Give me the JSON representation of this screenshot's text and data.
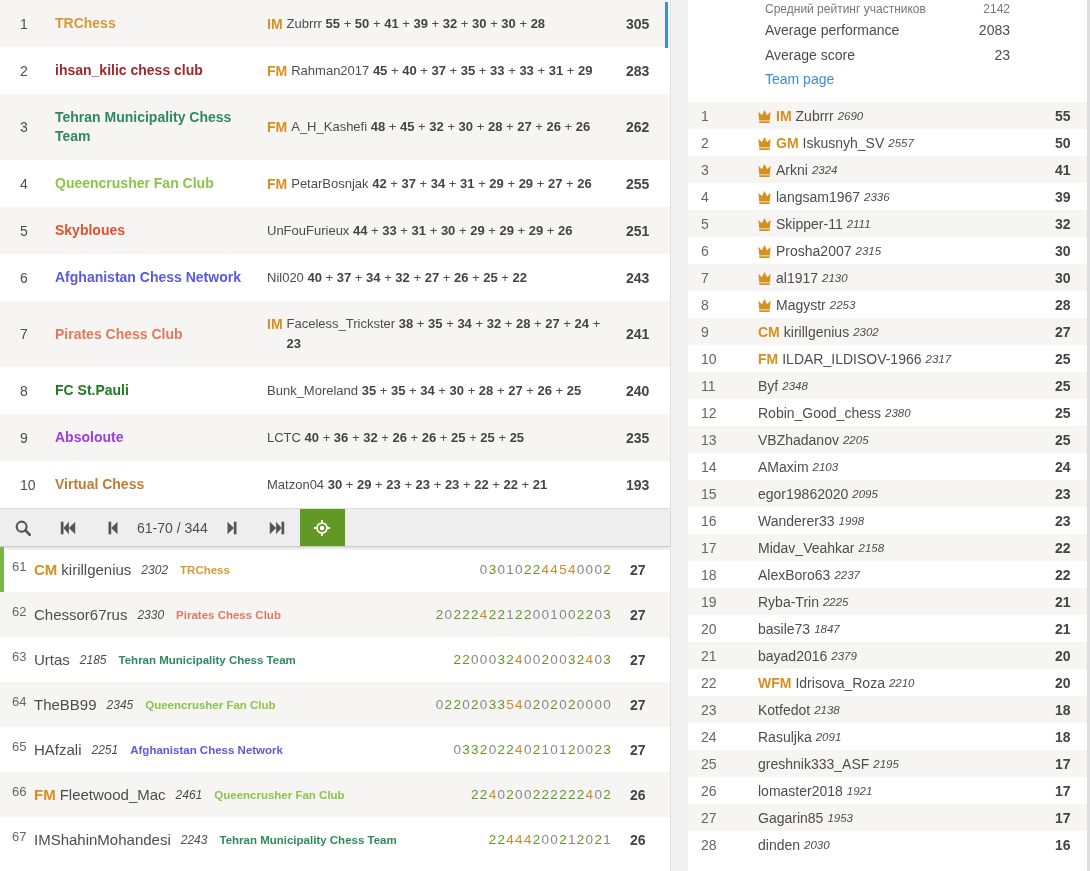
{
  "team_standings": {
    "rows": [
      {
        "rank": "1",
        "team": "TRChess",
        "color": "#d59a35",
        "leader": {
          "title": "IM",
          "line": "Zubrrr **55** + **50** + **41** + **39** + **32** + **30** + **30** + **28**"
        },
        "total": "305"
      },
      {
        "rank": "2",
        "team": "ihsan_kilic chess club",
        "color": "#a3282e",
        "leader": {
          "title": "FM",
          "line": "Rahman2017 **45** + **40** + **37** + **35** + **33** + **33** + **31** + **29**"
        },
        "total": "283"
      },
      {
        "rank": "3",
        "team": "Tehran Municipality Chess Team",
        "color": "#2e8a5c",
        "leader": {
          "title": "FM",
          "line": "A_H_Kashefi **48** + **45** + **32** + **30** + **28** + **27** + **26** + **26**"
        },
        "total": "262"
      },
      {
        "rank": "4",
        "team": "Queencrusher Fan Club",
        "color": "#8cc44a",
        "leader": {
          "title": "FM",
          "line": "PetarBosnjak **42** + **37** + **34** + **31** + **29** + **29** + **27** + **26**"
        },
        "total": "255"
      },
      {
        "rank": "5",
        "team": "Skybloues",
        "color": "#e4502a",
        "leader": {
          "line": "UnFouFurieux **44** + **33** + **31** + **30** + **29** + **29** + **29** + **26**"
        },
        "total": "251"
      },
      {
        "rank": "6",
        "team": "Afghanistan Chess Network",
        "color": "#5a5ae0",
        "leader": {
          "line": "Nil020 **40** + **37** + **34** + **32** + **27** + **26** + **25** + **22**"
        },
        "total": "243"
      },
      {
        "rank": "7",
        "team": "Pirates Chess Club",
        "color": "#e07a5c",
        "leader": {
          "title": "IM",
          "line": "Faceless_Trickster **38** + **35** + **34** + **32** + **28** + **27** + **24** + **23**"
        },
        "total": "241"
      },
      {
        "rank": "8",
        "team": "FC St.Pauli",
        "color": "#1f7a22",
        "leader": {
          "line": "Bunk_Moreland **35** + **35** + **34** + **30** + **28** + **27** + **26** + **25**"
        },
        "total": "240"
      },
      {
        "rank": "9",
        "team": "Absoloute",
        "color": "#9a3ee0",
        "leader": {
          "line": "LCTC **40** + **36** + **32** + **26** + **26** + **25** + **25** + **25**"
        },
        "total": "235"
      },
      {
        "rank": "10",
        "team": "Virtual Chess",
        "color": "#c27a35",
        "leader": {
          "line": "Matzon04 **30** + **29** + **23** + **23** + **23** + **22** + **22** + **21**"
        },
        "total": "193"
      }
    ]
  },
  "pager": {
    "range": "61-70 / 344"
  },
  "players": [
    {
      "rank": "61",
      "title": "CM",
      "name": "kirillgenius",
      "rating": "2302",
      "team": "TRChess",
      "color": "#d59a35",
      "sheet": "030102244540002",
      "score": "27",
      "selected": true
    },
    {
      "rank": "62",
      "name": "Chessor67rus",
      "rating": "2330",
      "team": "Pirates Chess Club",
      "color": "#e07a5c",
      "sheet": "20222422122001002203",
      "score": "27",
      "selected": false
    },
    {
      "rank": "63",
      "name": "Urtas",
      "rating": "2185",
      "team": "Tehran Municipality Chess Team",
      "color": "#2e8a5c",
      "sheet": "220003240020032403",
      "score": "27",
      "selected": false
    },
    {
      "rank": "64",
      "name": "TheBB99",
      "rating": "2345",
      "team": "Queencrusher Fan Club",
      "color": "#8cc44a",
      "sheet": "02202033540202020000",
      "score": "27",
      "selected": false
    },
    {
      "rank": "65",
      "name": "HAfzali",
      "rating": "2251",
      "team": "Afghanistan Chess Network",
      "color": "#5a5ae0",
      "sheet": "033202240210120023",
      "score": "27",
      "selected": false
    },
    {
      "rank": "66",
      "title": "FM",
      "name": "Fleetwood_Mac",
      "rating": "2461",
      "team": "Queencrusher Fan Club",
      "color": "#8cc44a",
      "sheet": "2240200222222402",
      "score": "26",
      "selected": false
    },
    {
      "rank": "67",
      "name": "IMShahinMohandesi",
      "rating": "2243",
      "team": "Tehran Municipality Chess Team",
      "color": "#2e8a5c",
      "sheet": "22444200212021",
      "score": "26",
      "selected": false
    }
  ],
  "team_info": {
    "stats": [
      {
        "label": "Средний рейтинг участников",
        "value": "2142"
      },
      {
        "label": "Average performance",
        "value": "2083"
      },
      {
        "label": "Average score",
        "value": "23"
      }
    ],
    "link": "Team page"
  },
  "members": [
    {
      "rank": "1",
      "crown": true,
      "title": "IM",
      "name": "Zubrrr",
      "rating": "2690",
      "score": "55"
    },
    {
      "rank": "2",
      "crown": true,
      "title": "GM",
      "name": "Iskusnyh_SV",
      "rating": "2557",
      "score": "50"
    },
    {
      "rank": "3",
      "crown": true,
      "name": "Arkni",
      "rating": "2324",
      "score": "41"
    },
    {
      "rank": "4",
      "crown": true,
      "name": "langsam1967",
      "rating": "2336",
      "score": "39"
    },
    {
      "rank": "5",
      "crown": true,
      "name": "Skipper-11",
      "rating": "2111",
      "score": "32"
    },
    {
      "rank": "6",
      "crown": true,
      "name": "Prosha2007",
      "rating": "2315",
      "score": "30"
    },
    {
      "rank": "7",
      "crown": true,
      "name": "al1917",
      "rating": "2130",
      "score": "30"
    },
    {
      "rank": "8",
      "crown": true,
      "name": "Magystr",
      "rating": "2253",
      "score": "28"
    },
    {
      "rank": "9",
      "crown": false,
      "title": "CM",
      "name": "kirillgenius",
      "rating": "2302",
      "score": "27"
    },
    {
      "rank": "10",
      "crown": false,
      "title": "FM",
      "name": "ILDAR_ILDISOV-1966",
      "rating": "2317",
      "score": "25"
    },
    {
      "rank": "11",
      "crown": false,
      "name": "Byf",
      "rating": "2348",
      "score": "25"
    },
    {
      "rank": "12",
      "crown": false,
      "name": "Robin_Good_chess",
      "rating": "2380",
      "score": "25"
    },
    {
      "rank": "13",
      "crown": false,
      "name": "VBZhadanov",
      "rating": "2205",
      "score": "25"
    },
    {
      "rank": "14",
      "crown": false,
      "name": "AMaxim",
      "rating": "2103",
      "score": "24"
    },
    {
      "rank": "15",
      "crown": false,
      "name": "egor19862020",
      "rating": "2095",
      "score": "23"
    },
    {
      "rank": "16",
      "crown": false,
      "name": "Wanderer33",
      "rating": "1998",
      "score": "23"
    },
    {
      "rank": "17",
      "crown": false,
      "name": "Midav_Veahkar",
      "rating": "2158",
      "score": "22"
    },
    {
      "rank": "18",
      "crown": false,
      "name": "AlexBoro63",
      "rating": "2237",
      "score": "22"
    },
    {
      "rank": "19",
      "crown": false,
      "name": "Ryba-Trin",
      "rating": "2225",
      "score": "21"
    },
    {
      "rank": "20",
      "crown": false,
      "name": "basile73",
      "rating": "1847",
      "score": "21"
    },
    {
      "rank": "21",
      "crown": false,
      "name": "bayad2016",
      "rating": "2379",
      "score": "20"
    },
    {
      "rank": "22",
      "crown": false,
      "title": "WFM",
      "name": "Idrisova_Roza",
      "rating": "2210",
      "score": "20"
    },
    {
      "rank": "23",
      "crown": false,
      "name": "Kotfedot",
      "rating": "2138",
      "score": "18"
    },
    {
      "rank": "24",
      "crown": false,
      "name": "Rasuljka",
      "rating": "2091",
      "score": "18"
    },
    {
      "rank": "25",
      "crown": false,
      "name": "greshnik333_ASF",
      "rating": "2195",
      "score": "17"
    },
    {
      "rank": "26",
      "crown": false,
      "name": "lomaster2018",
      "rating": "1921",
      "score": "17"
    },
    {
      "rank": "27",
      "crown": false,
      "name": "Gagarin85",
      "rating": "1953",
      "score": "17"
    },
    {
      "rank": "28",
      "crown": false,
      "name": "dinden",
      "rating": "2030",
      "score": "16"
    }
  ]
}
